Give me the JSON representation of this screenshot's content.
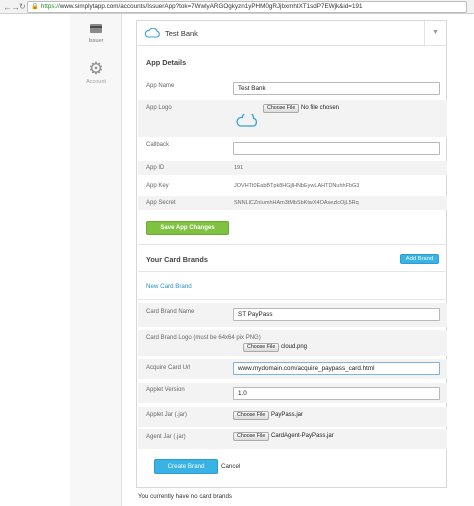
{
  "browser": {
    "url_scheme": "https://",
    "url_rest": "www.simplytapp.com/accounts/IssuerApp?tok=7WwlyARGOgkyzn1yPHM0gRJjbxmhtXT1sdP7EWjk&id=191",
    "back_icon": "arrow-left-icon",
    "forward_icon": "arrow-right-icon",
    "reload_icon": "reload-icon",
    "lock_icon": "lock-icon"
  },
  "sidebar": {
    "items": [
      {
        "label": "Issuer",
        "icon": "card-icon"
      },
      {
        "label": "Account",
        "icon": "gear-icon"
      }
    ]
  },
  "bank": {
    "name": "Test Bank",
    "icon": "cloud-icon",
    "toggle_icon": "chevron-down-icon"
  },
  "app_details": {
    "title": "App Details",
    "name_label": "App Name",
    "name_value": "Test Bank",
    "logo_label": "App Logo",
    "choose_file": "Choose File",
    "no_file": "No file chosen",
    "callback_label": "Callback",
    "callback_value": "",
    "appid_label": "App ID",
    "appid_value": "191",
    "appkey_label": "App Key",
    "appkey_value": "JOVHTt0EabBTpk8HGjlHNbEywLAHTDNuhhFbG3",
    "appsecret_label": "App Secret",
    "appsecret_value": "SNNLlCZnIumhHAm3tMbSbKtwX4OAsezlcOjL5Rq",
    "save_button": "Save App Changes"
  },
  "card_brands": {
    "title": "Your Card Brands",
    "add_button": "Add Brand",
    "new_brand_link": "New Card Brand",
    "brand_name_label": "Card Brand Name",
    "brand_name_value": "ST PayPass",
    "brand_logo_label": "Card Brand Logo (must be 64x64 pix PNG)",
    "brand_logo_file": "cloud.png",
    "acquire_label": "Acquire Card Url",
    "acquire_value": "www.mydomain.com/acquire_paypass_card.html",
    "applet_version_label": "Applet Version",
    "applet_version_value": "1.0",
    "applet_jar_label": "Applet Jar (.jar)",
    "applet_jar_file": "PayPass.jar",
    "agent_jar_label": "Agent Jar (.jar)",
    "agent_jar_file": "CardAgent-PayPass.jar",
    "choose_file": "Choose File",
    "create_button": "Create Brand",
    "cancel_link": "Cancel"
  },
  "footer": {
    "empty_text": "You currently have no card brands"
  }
}
